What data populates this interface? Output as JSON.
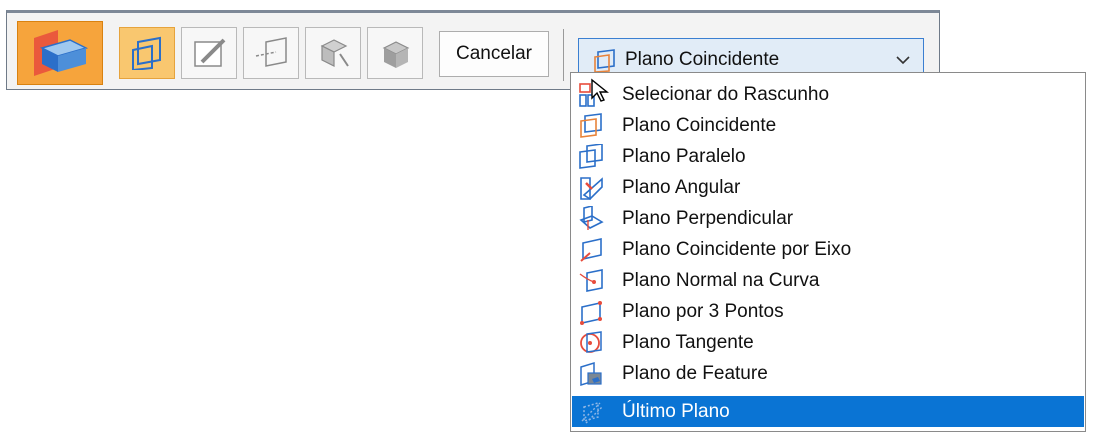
{
  "toolbar": {
    "feature_icon": "plane-feature-icon",
    "steps": [
      {
        "icon": "plane-placement-step-icon",
        "active": true
      },
      {
        "icon": "sketch-step-icon",
        "active": false
      },
      {
        "icon": "extent-step-icon",
        "active": false
      },
      {
        "icon": "side-step-icon",
        "active": false
      },
      {
        "icon": "treatment-step-icon",
        "active": false
      }
    ],
    "cancel_label": "Cancelar"
  },
  "plane_select": {
    "value": "Plano Coincidente",
    "icon": "coincident-plane-icon"
  },
  "dropdown": {
    "items": [
      {
        "label": "Selecionar do Rascunho",
        "icon": "select-from-sketch-icon"
      },
      {
        "label": "Plano Coincidente",
        "icon": "coincident-plane-icon"
      },
      {
        "label": "Plano Paralelo",
        "icon": "parallel-plane-icon"
      },
      {
        "label": "Plano Angular",
        "icon": "angular-plane-icon"
      },
      {
        "label": "Plano Perpendicular",
        "icon": "perpendicular-plane-icon"
      },
      {
        "label": "Plano Coincidente por Eixo",
        "icon": "coincident-by-axis-plane-icon"
      },
      {
        "label": "Plano Normal na Curva",
        "icon": "normal-to-curve-plane-icon"
      },
      {
        "label": "Plano por 3 Pontos",
        "icon": "three-points-plane-icon"
      },
      {
        "label": "Plano Tangente",
        "icon": "tangent-plane-icon"
      },
      {
        "label": "Plano de Feature",
        "icon": "feature-plane-icon"
      },
      {
        "label": "Último Plano",
        "icon": "last-plane-icon"
      }
    ],
    "highlighted_index": 10
  },
  "colors": {
    "accent_orange": "#f6a43c",
    "highlight_blue": "#0a74d4",
    "select_bg": "#e1ecf7",
    "plane_icon_orange": "#e8833a",
    "plane_icon_blue": "#2b6fc9"
  }
}
